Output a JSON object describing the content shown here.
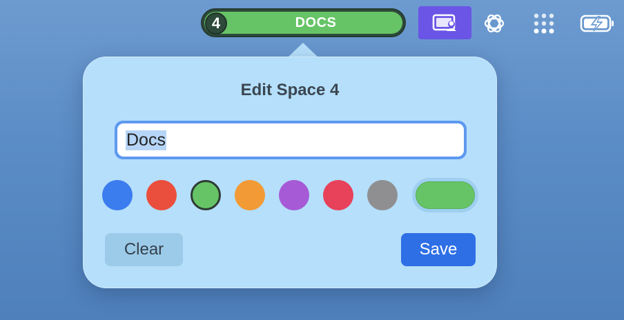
{
  "menubar": {
    "space_number": "4",
    "space_name": "DOCS",
    "icons": [
      "screen-share-icon",
      "openai-icon",
      "grid-dots-icon",
      "battery-charging-icon"
    ]
  },
  "popover": {
    "title": "Edit Space 4",
    "name_input_value": "Docs",
    "swatches": [
      {
        "name": "blue",
        "color": "#3b7cef",
        "selected": false
      },
      {
        "name": "red",
        "color": "#ea4e3c",
        "selected": false
      },
      {
        "name": "green",
        "color": "#66c466",
        "selected": true
      },
      {
        "name": "orange",
        "color": "#f29a35",
        "selected": false
      },
      {
        "name": "purple",
        "color": "#a65ad6",
        "selected": false
      },
      {
        "name": "pink",
        "color": "#e8415a",
        "selected": false
      },
      {
        "name": "gray",
        "color": "#8f8f92",
        "selected": false
      }
    ],
    "preview_color": "#66c466",
    "clear_label": "Clear",
    "save_label": "Save"
  },
  "colors": {
    "accent": "#2e6fe6",
    "popover_bg": "#b5dffa",
    "space_pill": "#66c466"
  }
}
